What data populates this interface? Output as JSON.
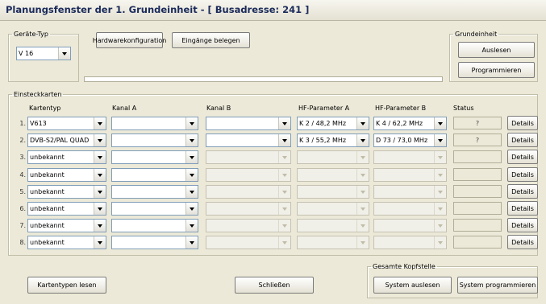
{
  "window": {
    "title": "Planungsfenster der 1. Grundeinheit - [ Busadresse: 241 ]"
  },
  "device_type": {
    "legend": "Geräte-Typ",
    "value": "V 16",
    "hardware_button": "Hardwarekonfiguration",
    "inputs_button": "Eingänge belegen"
  },
  "grundeinheit": {
    "legend": "Grundeinheit",
    "read_button": "Auslesen",
    "program_button": "Programmieren"
  },
  "cards": {
    "legend": "Einsteckkarten",
    "headers": {
      "kartentyp": "Kartentyp",
      "kanal_a": "Kanal A",
      "kanal_b": "Kanal B",
      "hf_a": "HF-Parameter A",
      "hf_b": "HF-Parameter B",
      "status": "Status"
    },
    "details_label": "Details",
    "rows": [
      {
        "num": "1.",
        "kartentyp": "V613",
        "kanal_a": "",
        "kanal_b": "",
        "hf_a": "K 2 / 48,2 MHz",
        "hf_b": "K 4 / 62,2 MHz",
        "status": "?"
      },
      {
        "num": "2.",
        "kartentyp": "DVB-S2/PAL QUAD",
        "kanal_a": "",
        "kanal_b": "",
        "hf_a": "K 3 / 55,2 MHz",
        "hf_b": "D 73 / 73,0 MHz",
        "status": "?"
      },
      {
        "num": "3.",
        "kartentyp": "unbekannt",
        "kanal_a": "",
        "kanal_b": "",
        "hf_a": "",
        "hf_b": "",
        "status": ""
      },
      {
        "num": "4.",
        "kartentyp": "unbekannt",
        "kanal_a": "",
        "kanal_b": "",
        "hf_a": "",
        "hf_b": "",
        "status": ""
      },
      {
        "num": "5.",
        "kartentyp": "unbekannt",
        "kanal_a": "",
        "kanal_b": "",
        "hf_a": "",
        "hf_b": "",
        "status": ""
      },
      {
        "num": "6.",
        "kartentyp": "unbekannt",
        "kanal_a": "",
        "kanal_b": "",
        "hf_a": "",
        "hf_b": "",
        "status": ""
      },
      {
        "num": "7.",
        "kartentyp": "unbekannt",
        "kanal_a": "",
        "kanal_b": "",
        "hf_a": "",
        "hf_b": "",
        "status": ""
      },
      {
        "num": "8.",
        "kartentyp": "unbekannt",
        "kanal_a": "",
        "kanal_b": "",
        "hf_a": "",
        "hf_b": "",
        "status": ""
      }
    ]
  },
  "footer": {
    "read_card_types_button": "Kartentypen lesen",
    "close_button": "Schließen",
    "headend_legend": "Gesamte Kopfstelle",
    "system_read_button": "System auslesen",
    "system_program_button": "System programmieren"
  }
}
